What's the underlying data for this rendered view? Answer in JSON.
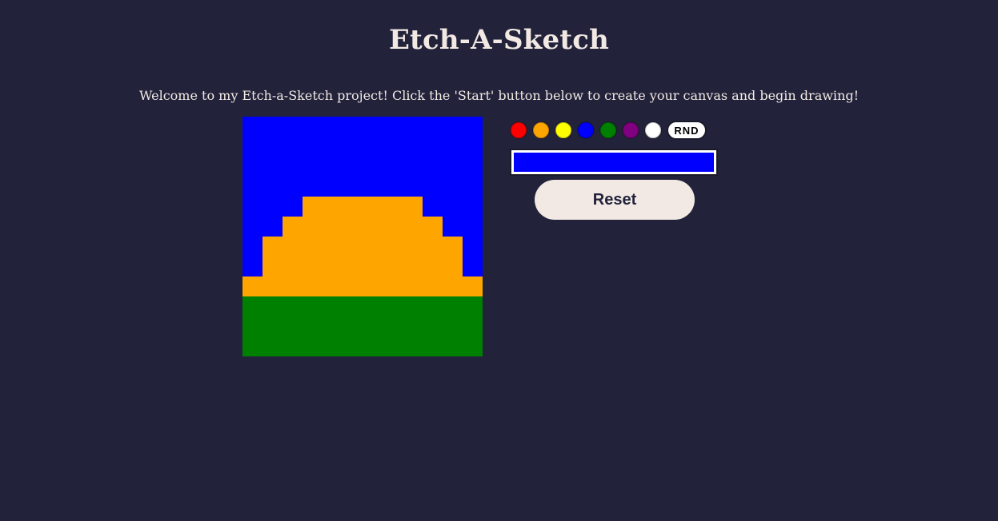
{
  "title": "Etch-A-Sketch",
  "welcome_text": "Welcome to my Etch-a-Sketch project! Click the 'Start' button below to create your canvas and begin drawing!",
  "palette": [
    {
      "name": "red",
      "color": "#ff0000"
    },
    {
      "name": "orange",
      "color": "#ffa500"
    },
    {
      "name": "yellow",
      "color": "#ffff00"
    },
    {
      "name": "blue",
      "color": "#0000ff"
    },
    {
      "name": "green",
      "color": "#008000"
    },
    {
      "name": "purple",
      "color": "#800080"
    },
    {
      "name": "white",
      "color": "#ffffff"
    }
  ],
  "random_button_label": "RND",
  "current_color": "#0000ff",
  "reset_button_label": "Reset",
  "canvas": {
    "grid_size": 12,
    "colors": {
      "B": "#0000ff",
      "O": "#ffa500",
      "G": "#008000"
    },
    "rows": [
      "BBBBBBBBBBBB",
      "BBBBBBBBBBBB",
      "BBBBBBBBBBBB",
      "BBBBBBBBBBBB",
      "BBBOOOOOOBBB",
      "BBOOOOOOOOBB",
      "BOOOOOOOOOOB",
      "BOOOOOOOOOOB",
      "OOOOOOOOOOOO",
      "GGGGGGGGGGGG",
      "GGGGGGGGGGGG",
      "GGGGGGGGGGGG"
    ]
  }
}
